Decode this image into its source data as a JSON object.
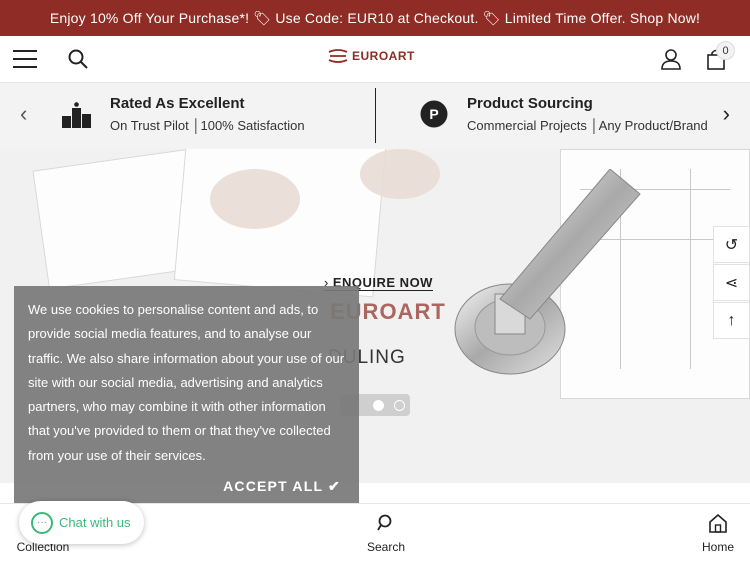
{
  "announcement": "Enjoy 10% Off Your Purchase*! 🏷 Use Code: EUR10 at Checkout. 🏷 Limited Time Offer. Shop Now!",
  "header": {
    "logo_text": "EUROART",
    "cart_count": "0"
  },
  "trust": [
    {
      "title": "Rated As Excellent",
      "subtitle": "On Trust Pilot │100% Satisfaction",
      "icon": "podium-icon"
    },
    {
      "title": "Product Sourcing",
      "subtitle": "Commercial Projects │Any Product/Brand",
      "icon": "parking-p-icon"
    }
  ],
  "hero": {
    "enquire": "ENQUIRE NOW",
    "brand": "EUROART",
    "scheduling": "DULING"
  },
  "cookie": {
    "text": "We use cookies to personalise content and ads, to provide social media features, and to analyse our traffic. We also share information about your use of our site with our social media, advertising and analytics partners, who may combine it with other information that you've provided to them or that they've collected from your use of their services.",
    "accept": "ACCEPT ALL ✔"
  },
  "chat": {
    "label": "Chat with us"
  },
  "bottom_nav": [
    {
      "label": "Collection",
      "icon": "grid-icon"
    },
    {
      "label": "Search",
      "icon": "search-icon"
    },
    {
      "label": "Home",
      "icon": "home-icon"
    }
  ],
  "colors": {
    "brand": "#8e2c25",
    "chat": "#3cb878"
  }
}
